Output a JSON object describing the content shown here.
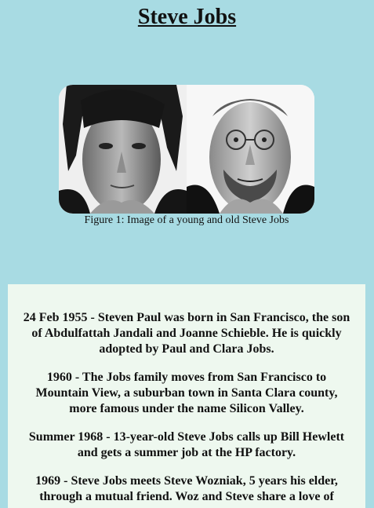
{
  "page": {
    "title": "Steve Jobs"
  },
  "figure": {
    "caption": "Figure 1: Image of a young and old Steve Jobs"
  },
  "timeline": [
    "24 Feb 1955 - Steven Paul was born in San Francisco, the son of Abdulfattah Jandali and Joanne Schieble. He is quickly adopted by Paul and Clara Jobs.",
    "1960 - The Jobs family moves from San Francisco to Mountain View, a suburban town in Santa Clara county, more famous under the name Silicon Valley.",
    "Summer 1968 - 13-year-old Steve Jobs calls up Bill Hewlett and gets a summer job at the HP factory.",
    "1969 - Steve Jobs meets Steve Wozniak, 5 years his elder, through a mutual friend. Woz and Steve share a love of"
  ],
  "colors": {
    "page_background": "#a8dbe3",
    "timeline_background": "#eef8ef"
  }
}
